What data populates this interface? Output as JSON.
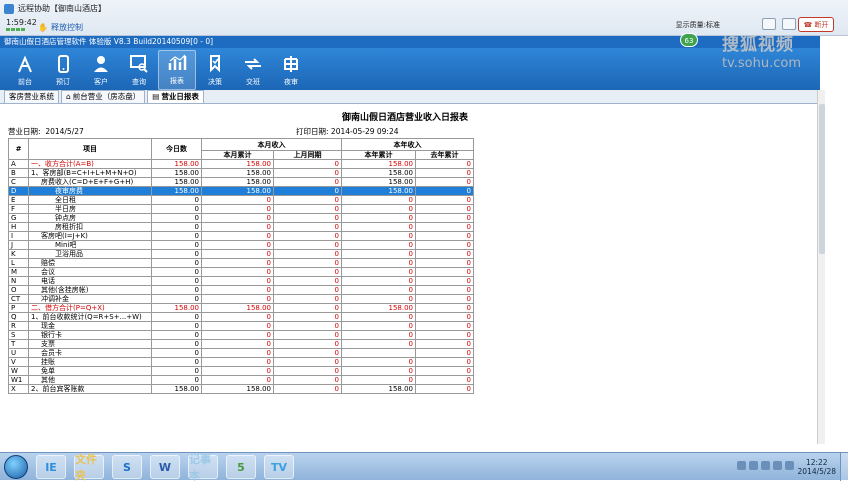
{
  "remote": {
    "title": "远程协助【御南山酒店】",
    "timer": "1:59:42",
    "release_control": "释放控制",
    "quality": "显示质量:标准",
    "hangup": "断开"
  },
  "app": {
    "title": "御南山假日酒店管理软件   体验版  V8.3 Build20140509[0 - 0]",
    "badge": "63",
    "watermark_line1": "搜狐视频",
    "watermark_line2": "tv.sohu.com"
  },
  "toolbar": [
    {
      "label": "前台",
      "icon": "front-desk-icon"
    },
    {
      "label": "预订",
      "icon": "phone-icon"
    },
    {
      "label": "客户",
      "icon": "user-icon"
    },
    {
      "label": "查询",
      "icon": "search-monitor-icon"
    },
    {
      "label": "报表",
      "icon": "chart-icon"
    },
    {
      "label": "决策",
      "icon": "decision-icon"
    },
    {
      "label": "交班",
      "icon": "handover-icon"
    },
    {
      "label": "夜审",
      "icon": "audit-icon"
    }
  ],
  "tabs": [
    {
      "label": "客房营业系统"
    },
    {
      "label": "前台营业（房态盘）"
    },
    {
      "label": "营业日报表"
    }
  ],
  "report": {
    "title": "御南山假日酒店营业收入日报表",
    "biz_date_label": "营业日期:",
    "biz_date": "2014/5/27",
    "print_date_label": "打印日期:",
    "print_date": "2014-05-29 09:24",
    "headers": {
      "hash": "#",
      "item": "项目",
      "today": "今日数",
      "month_group": "本月收入",
      "month_total": "本月累计",
      "month_last_year": "上月同期",
      "year_group": "本年收入",
      "year_total": "本年累计",
      "last_year_total": "去年累计"
    },
    "rows": [
      {
        "code": "A",
        "name": "一、收方合计(A=B)",
        "indent": 0,
        "red": true,
        "vals": [
          "158.00",
          "158.00",
          "0",
          "158.00",
          "0"
        ]
      },
      {
        "code": "B",
        "name": "1、客房部(B=C+I+L+M+N+O)",
        "indent": 0,
        "red": false,
        "vals": [
          "158.00",
          "158.00",
          "0",
          "158.00",
          "0"
        ]
      },
      {
        "code": "C",
        "name": "房费收入(C=D+E+F+G+H)",
        "indent": 1,
        "red": false,
        "vals": [
          "158.00",
          "158.00",
          "0",
          "158.00",
          "0"
        ]
      },
      {
        "code": "D",
        "name": "夜审房费",
        "indent": 2,
        "red": false,
        "sel": true,
        "vals": [
          "158.00",
          "158.00",
          "0",
          "158.00",
          "0"
        ]
      },
      {
        "code": "E",
        "name": "全日租",
        "indent": 2,
        "red": false,
        "vals": [
          "0",
          "0",
          "0",
          "0",
          "0"
        ]
      },
      {
        "code": "F",
        "name": "半日房",
        "indent": 2,
        "red": false,
        "vals": [
          "0",
          "0",
          "0",
          "0",
          "0"
        ]
      },
      {
        "code": "G",
        "name": "钟点房",
        "indent": 2,
        "red": false,
        "vals": [
          "0",
          "0",
          "0",
          "0",
          "0"
        ]
      },
      {
        "code": "H",
        "name": "房租折扣",
        "indent": 2,
        "red": false,
        "vals": [
          "0",
          "0",
          "0",
          "0",
          "0"
        ]
      },
      {
        "code": "I",
        "name": "客房吧(I=J+K)",
        "indent": 1,
        "red": false,
        "vals": [
          "0",
          "0",
          "0",
          "0",
          "0"
        ]
      },
      {
        "code": "J",
        "name": "Mini吧",
        "indent": 2,
        "red": false,
        "vals": [
          "0",
          "0",
          "0",
          "0",
          "0"
        ]
      },
      {
        "code": "K",
        "name": "卫浴用品",
        "indent": 2,
        "red": false,
        "vals": [
          "0",
          "0",
          "0",
          "0",
          "0"
        ]
      },
      {
        "code": "L",
        "name": "赔偿",
        "indent": 1,
        "red": false,
        "vals": [
          "0",
          "0",
          "0",
          "0",
          "0"
        ]
      },
      {
        "code": "M",
        "name": "会议",
        "indent": 1,
        "red": false,
        "vals": [
          "0",
          "0",
          "0",
          "0",
          "0"
        ]
      },
      {
        "code": "N",
        "name": "电话",
        "indent": 1,
        "red": false,
        "vals": [
          "0",
          "0",
          "0",
          "0",
          "0"
        ]
      },
      {
        "code": "O",
        "name": "其他(含挂房帐)",
        "indent": 1,
        "red": false,
        "vals": [
          "0",
          "0",
          "0",
          "0",
          "0"
        ]
      },
      {
        "code": "CT",
        "name": "冲调补金",
        "indent": 1,
        "red": false,
        "vals": [
          "0",
          "0",
          "0",
          "0",
          "0"
        ]
      },
      {
        "code": "P",
        "name": "二、借方合计(P=Q+X)",
        "indent": 0,
        "red": true,
        "vals": [
          "158.00",
          "158.00",
          "0",
          "158.00",
          "0"
        ]
      },
      {
        "code": "Q",
        "name": "1、前台收款统计(Q=R+S+...+W)",
        "indent": 0,
        "red": false,
        "vals": [
          "0",
          "0",
          "0",
          "0",
          "0"
        ]
      },
      {
        "code": "R",
        "name": "现金",
        "indent": 1,
        "red": false,
        "vals": [
          "0",
          "0",
          "0",
          "0",
          "0"
        ]
      },
      {
        "code": "S",
        "name": "银行卡",
        "indent": 1,
        "red": false,
        "vals": [
          "0",
          "0",
          "0",
          "0",
          "0"
        ]
      },
      {
        "code": "T",
        "name": "支票",
        "indent": 1,
        "red": false,
        "vals": [
          "0",
          "0",
          "0",
          "0",
          "0"
        ]
      },
      {
        "code": "U",
        "name": "会员卡",
        "indent": 1,
        "red": false,
        "vals": [
          "0",
          "0",
          "0",
          "",
          "0"
        ]
      },
      {
        "code": "V",
        "name": "挂账",
        "indent": 1,
        "red": false,
        "vals": [
          "0",
          "0",
          "0",
          "0",
          "0"
        ]
      },
      {
        "code": "W",
        "name": "免单",
        "indent": 1,
        "red": false,
        "vals": [
          "0",
          "0",
          "0",
          "0",
          "0"
        ]
      },
      {
        "code": "W1",
        "name": "其他",
        "indent": 1,
        "red": false,
        "vals": [
          "0",
          "0",
          "0",
          "0",
          "0"
        ]
      },
      {
        "code": "X",
        "name": "2、前台宾客账款",
        "indent": 0,
        "red": false,
        "vals": [
          "158.00",
          "158.00",
          "0",
          "158.00",
          "0"
        ]
      }
    ]
  },
  "taskbar": {
    "apps": [
      "IE",
      "文件夹",
      "S",
      "W",
      "记事本",
      "5",
      "TV"
    ],
    "time": "12:22",
    "date": "2014/5/28"
  }
}
